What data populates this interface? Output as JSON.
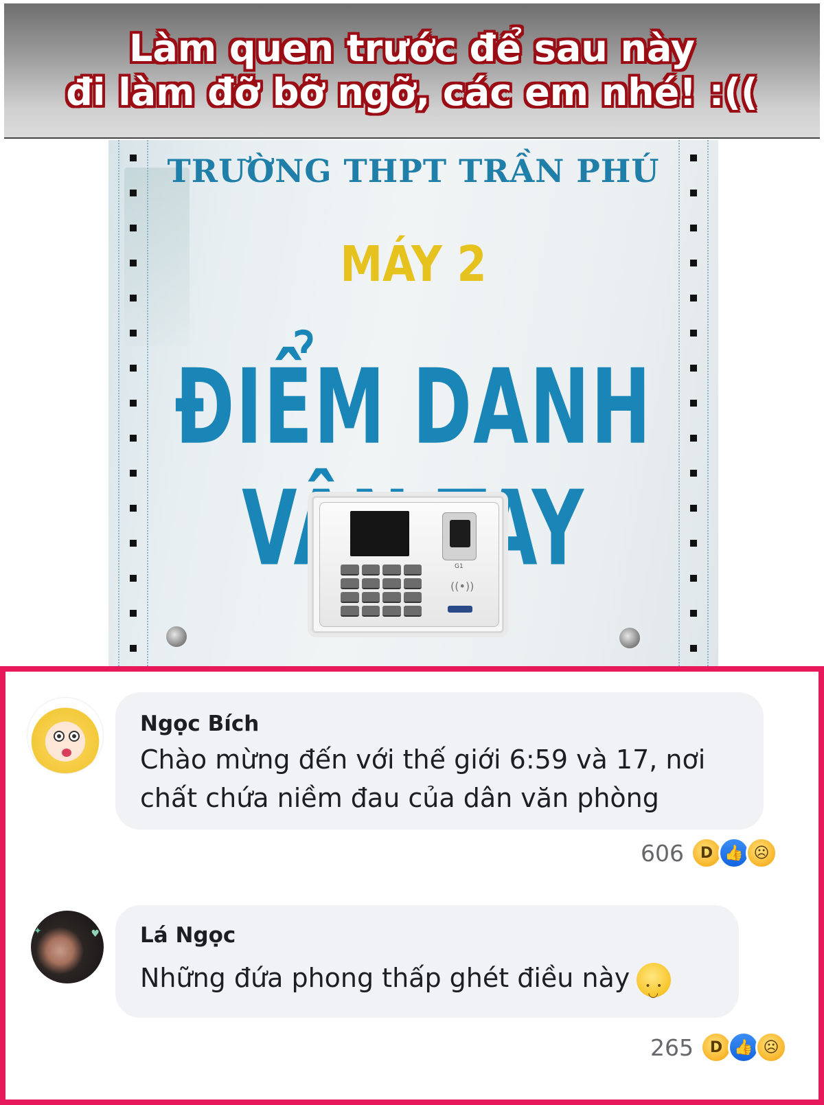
{
  "banner": {
    "line1": "Làm quen trước để sau này",
    "line2": "đi làm đỡ bỡ ngỡ, các em nhé! :(("
  },
  "sign": {
    "school": "TRƯỜNG THPT TRẦN PHÚ",
    "machine": "MÁY 2",
    "title": "ĐIỂM DANH VÂN TAY",
    "device_model": "G1"
  },
  "comments": [
    {
      "author": "Ngọc Bích",
      "text": "Chào mừng đến với thế giới 6:59 và 17, nơi chất chứa niềm đau của dân văn phòng",
      "reaction_count": "606",
      "reactions": [
        "haha-icon",
        "like-icon",
        "sad-icon"
      ]
    },
    {
      "author": "Lá Ngọc",
      "text": "Những đứa phong thấp ghét điều này",
      "emoji": "slightly-smiling-face-icon",
      "reaction_count": "265",
      "reactions": [
        "haha-icon",
        "like-icon",
        "sad-icon"
      ]
    }
  ],
  "colors": {
    "comment_frame": "#e8195a",
    "banner_text_outline": "#9b0d14",
    "sign_blue": "#1a86b8",
    "sign_yellow": "#e6c21f",
    "bubble_bg": "#f0f2f5"
  }
}
